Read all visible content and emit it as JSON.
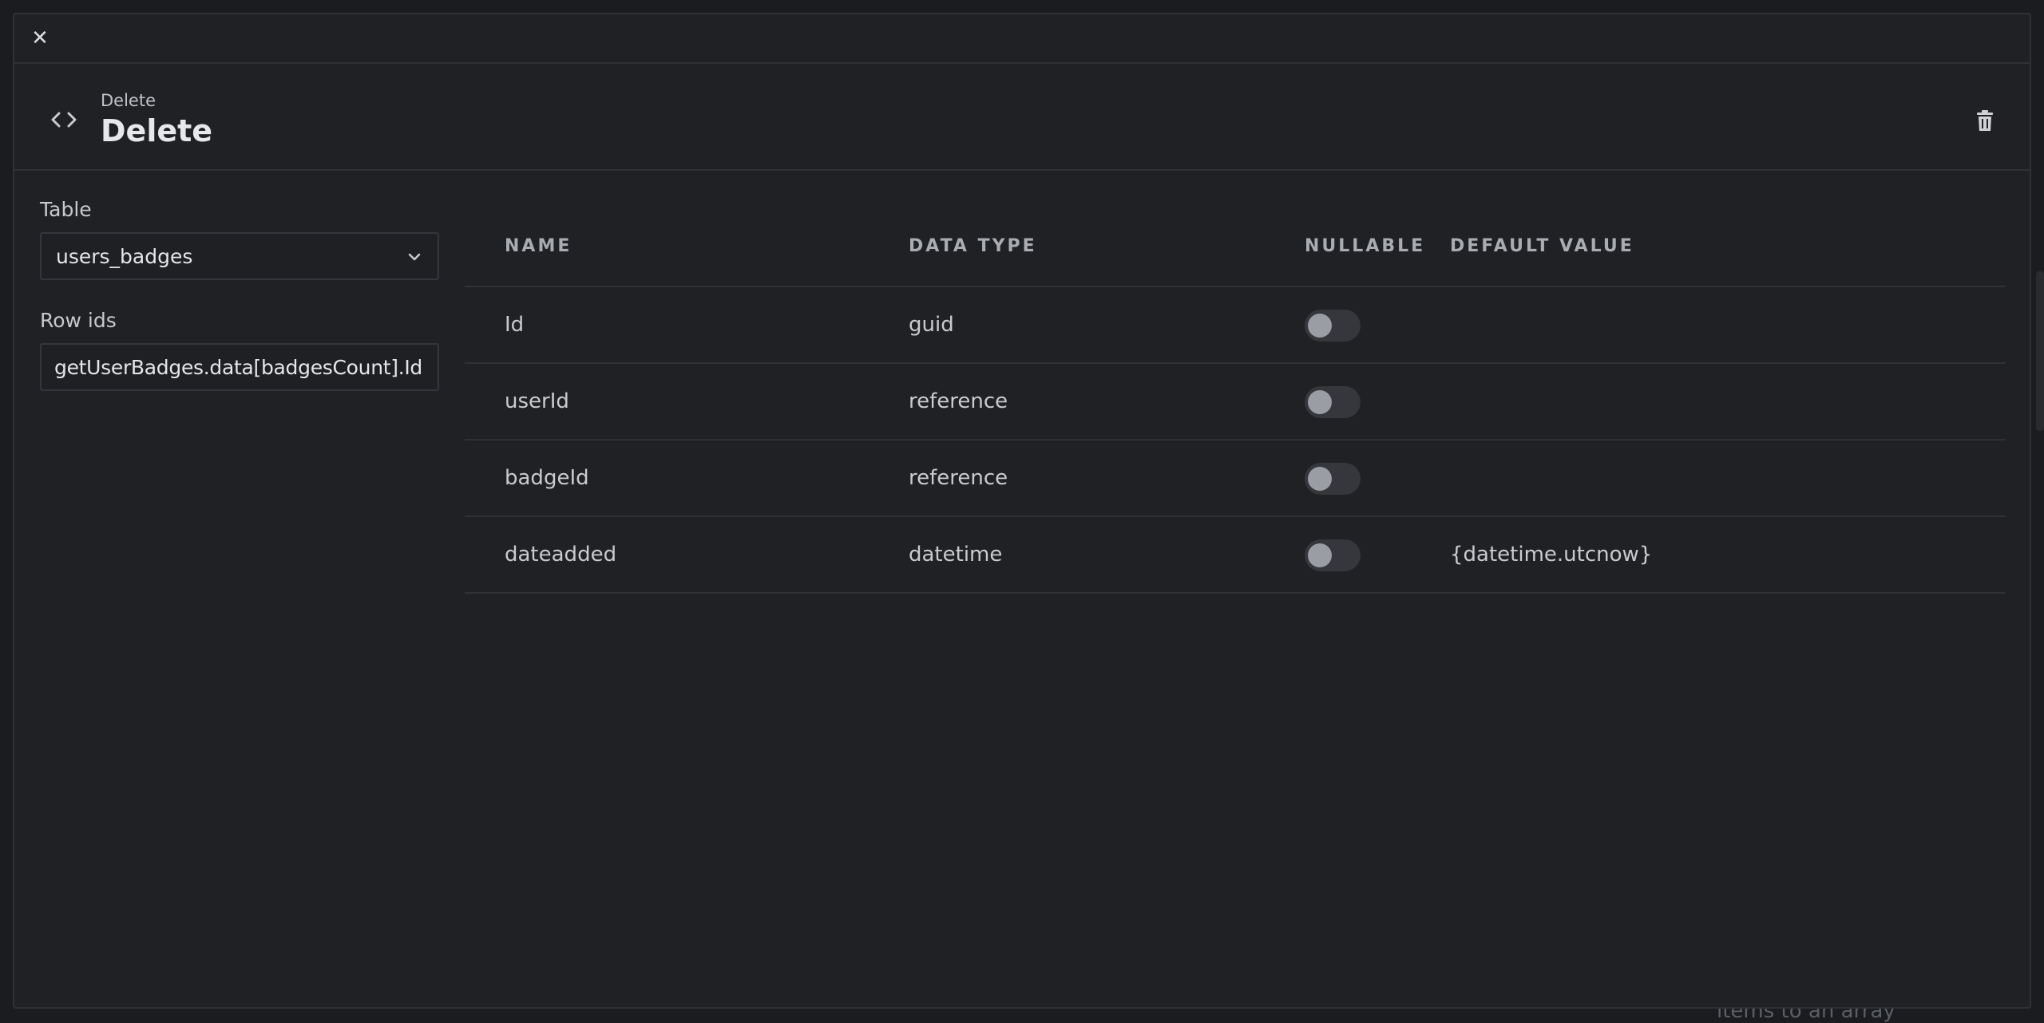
{
  "backdrop": {
    "partial_text": "items to an array"
  },
  "header": {
    "subtitle": "Delete",
    "title": "Delete"
  },
  "icons": {
    "close": "close-icon",
    "code": "code-icon",
    "trash": "trash-icon",
    "chevron": "chevron-down-icon"
  },
  "form": {
    "table_label": "Table",
    "table_value": "users_badges",
    "row_ids_label": "Row ids",
    "row_ids_value": "getUserBadges.data[badgesCount].Id"
  },
  "columns_table": {
    "headers": {
      "name": "NAME",
      "data_type": "DATA TYPE",
      "nullable": "NULLABLE",
      "default_value": "DEFAULT VALUE"
    },
    "rows": [
      {
        "name": "Id",
        "data_type": "guid",
        "nullable": false,
        "default_value": ""
      },
      {
        "name": "userId",
        "data_type": "reference",
        "nullable": false,
        "default_value": ""
      },
      {
        "name": "badgeId",
        "data_type": "reference",
        "nullable": false,
        "default_value": ""
      },
      {
        "name": "dateadded",
        "data_type": "datetime",
        "nullable": false,
        "default_value": "{datetime.utcnow}"
      }
    ]
  }
}
